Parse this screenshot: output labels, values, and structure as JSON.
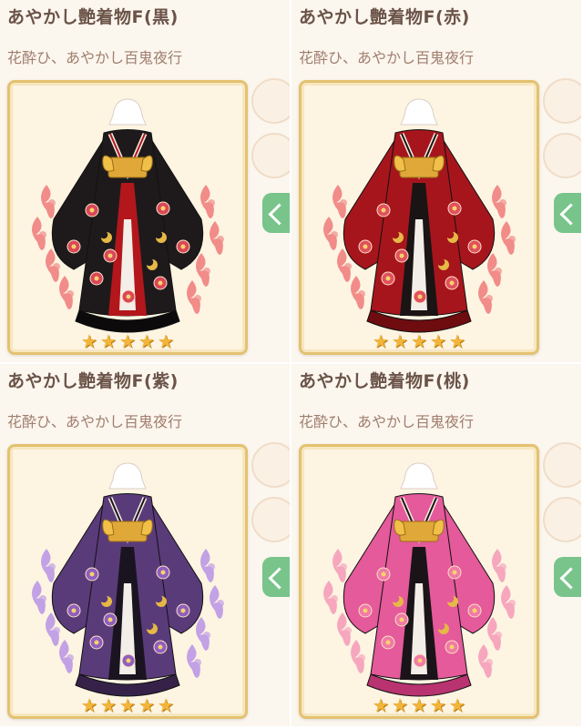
{
  "items": [
    {
      "title": "あやかし艶着物F(黒)",
      "subtitle": "花酔ひ、あやかし百鬼夜行",
      "stars": 5,
      "colors": {
        "robe": "#1e1a1c",
        "robe_dark": "#0c0a0b",
        "lining": "#b3171c",
        "flame": "#f07a7a",
        "flower": "#d9475a"
      }
    },
    {
      "title": "あやかし艶着物F(赤)",
      "subtitle": "花酔ひ、あやかし百鬼夜行",
      "stars": 5,
      "colors": {
        "robe": "#a7151c",
        "robe_dark": "#6f0c10",
        "lining": "#1a1414",
        "flame": "#f07a7a",
        "flower": "#e0505e"
      }
    },
    {
      "title": "あやかし艶着物F(紫)",
      "subtitle": "花酔ひ、あやかし百鬼夜行",
      "stars": 5,
      "colors": {
        "robe": "#5a3b7a",
        "robe_dark": "#362249",
        "lining": "#1a1420",
        "flame": "#b893e6",
        "flower": "#8f5fbf"
      }
    },
    {
      "title": "あやかし艶着物F(桃)",
      "subtitle": "花酔ひ、あやかし百鬼夜行",
      "stars": 5,
      "colors": {
        "robe": "#e45a9a",
        "robe_dark": "#b8336f",
        "lining": "#1a1418",
        "flame": "#f59ab8",
        "flower": "#f07aa8"
      }
    }
  ]
}
